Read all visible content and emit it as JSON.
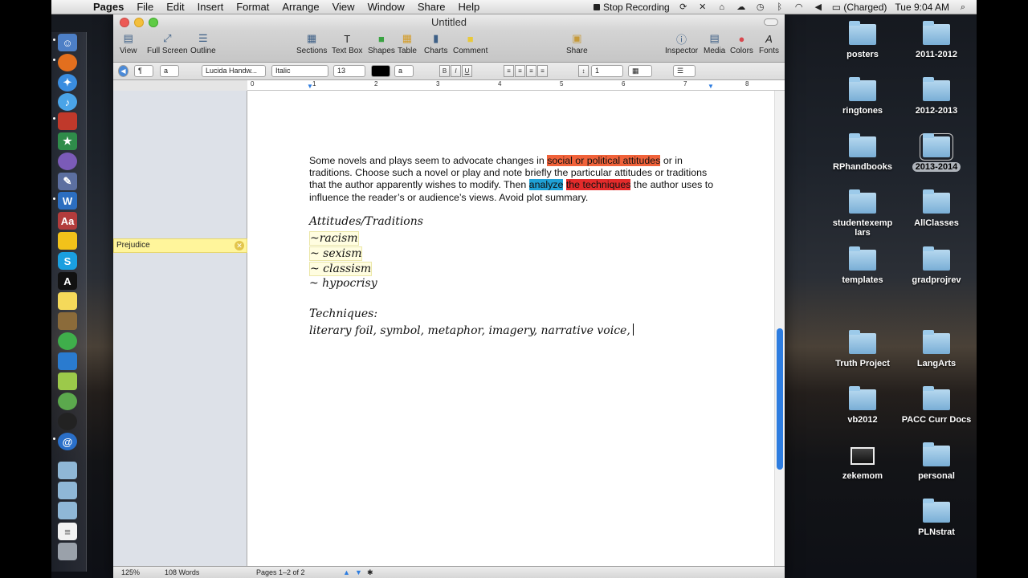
{
  "menubar": {
    "app": "Pages",
    "items": [
      "File",
      "Edit",
      "Insert",
      "Format",
      "Arrange",
      "View",
      "Window",
      "Share",
      "Help"
    ],
    "stop_recording": "Stop Recording",
    "battery": "(Charged)",
    "clock": "Tue 9:04 AM"
  },
  "window": {
    "title": "Untitled"
  },
  "toolbar": {
    "view": "View",
    "fullscreen": "Full Screen",
    "outline": "Outline",
    "sections": "Sections",
    "textbox": "Text Box",
    "shapes": "Shapes",
    "table": "Table",
    "charts": "Charts",
    "comment": "Comment",
    "share": "Share",
    "inspector": "Inspector",
    "media": "Media",
    "colors": "Colors",
    "fonts": "Fonts"
  },
  "formatbar": {
    "font": "Lucida Handw...",
    "style": "Italic",
    "size": "13",
    "line_spacing": "1",
    "style_a": "a",
    "para": "¶"
  },
  "ruler": [
    "0",
    "1",
    "2",
    "3",
    "4",
    "5",
    "6",
    "7",
    "8"
  ],
  "comment": {
    "text": "Prejudice"
  },
  "document": {
    "p1": "Some novels and plays seem to advocate changes in ",
    "hl1": "social or political attitudes",
    "p2": " or in traditions.  Choose such a novel or play and note briefly the particular attitudes or traditions that the author apparently wishes to modify.  Then ",
    "hl2": "analyze",
    "hl3": "the techniques",
    "p3": " the author uses to influence the reader’s or audience’s views.  Avoid plot summary.",
    "heading1": "Attitudes/Traditions",
    "list": [
      "~racism",
      "~ sexism",
      "~ classism",
      "~ hypocrisy"
    ],
    "heading2": "Techniques:",
    "techniques": "literary foil, symbol, metaphor, imagery, narrative voice,"
  },
  "status": {
    "zoom": "125%",
    "words": "108 Words",
    "pages": "Pages 1–2 of 2"
  },
  "desktop": {
    "folders": [
      "posters",
      "2011-2012",
      "ringtones",
      "2012-2013",
      "RPhandbooks",
      "2013-2014",
      "studentexemp lars",
      "AllClasses",
      "templates",
      "gradprojrev",
      "Truth Project",
      "LangArts",
      "vb2012",
      "PACC Curr Docs",
      "zekemom",
      "personal",
      "PLNstrat"
    ]
  }
}
